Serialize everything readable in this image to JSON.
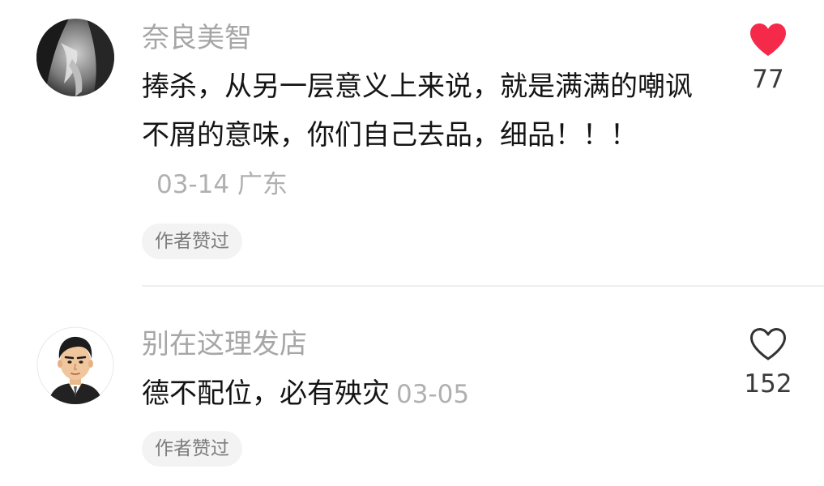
{
  "comments": [
    {
      "username": "奈良美智",
      "content": "捧杀，从另一层意义上来说，就是满满的嘲讽不屑的意味，你们自己去品，细品！！！",
      "meta": "03-14 广东",
      "author_liked": "作者赞过",
      "likes": "77",
      "liked": true,
      "like_icon": "heart-filled-icon",
      "like_color": "#f52a4b"
    },
    {
      "username": "别在这理发店",
      "content": "德不配位，必有殃灾",
      "meta": "03-05",
      "author_liked": "作者赞过",
      "likes": "152",
      "liked": false,
      "like_icon": "heart-outline-icon",
      "like_color": "#333333"
    }
  ]
}
